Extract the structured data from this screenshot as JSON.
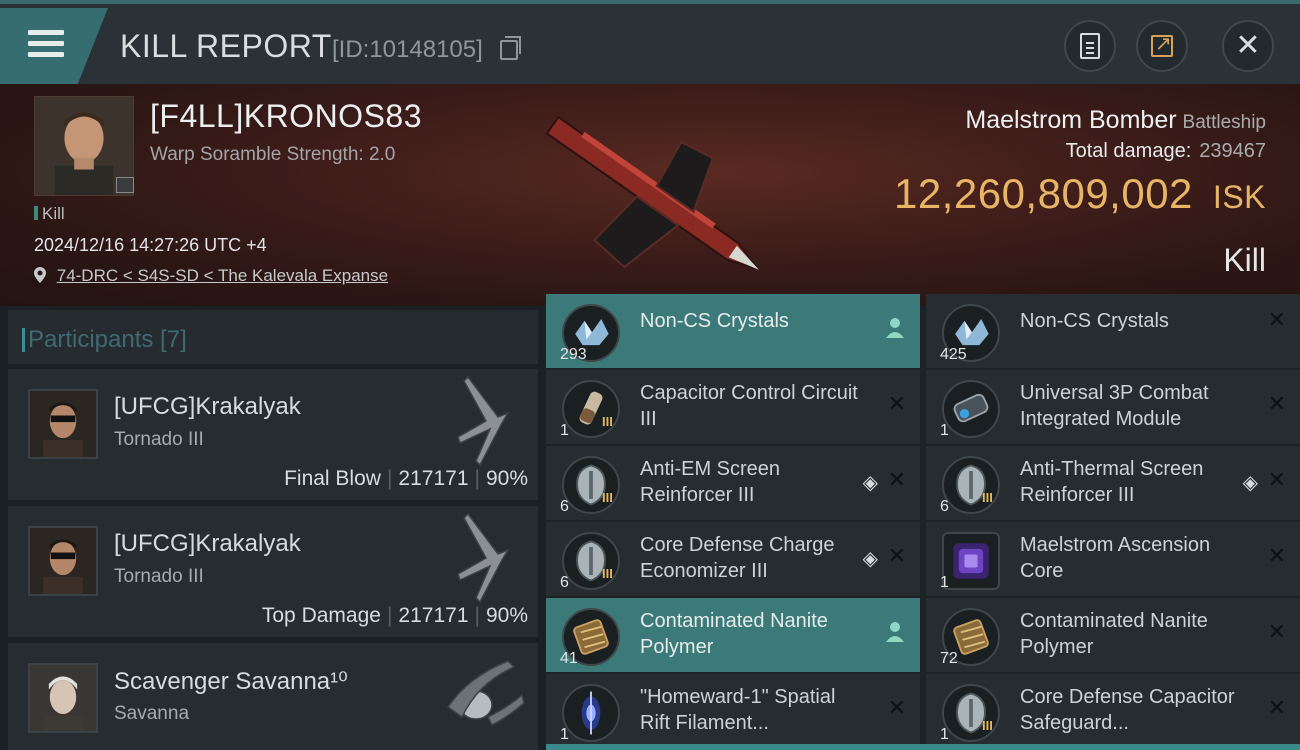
{
  "header": {
    "title": "KILL REPORT",
    "report_id": "[ID:10148105]"
  },
  "victim": {
    "name": "[F4LL]KRONOS83",
    "scramble": "Warp Soramble Strength: 2.0",
    "kill_tag": "Kill",
    "timestamp": "2024/12/16 14:27:26 UTC +4",
    "location": "74-DRC < S4S-SD < The Kalevala Expanse",
    "ship": "Maelstrom Bomber",
    "ship_class": "Battleship",
    "total_damage_label": "Total damage:",
    "total_damage": "239467",
    "isk_value": "12,260,809,002",
    "isk_unit": "ISK",
    "result": "Kill"
  },
  "participants": {
    "label": "Participants [7]",
    "rows": [
      {
        "name": "[UFCG]Krakalyak",
        "ship": "Tornado III",
        "role": "Final Blow",
        "damage": "217171",
        "percent": "90%"
      },
      {
        "name": "[UFCG]Krakalyak",
        "ship": "Tornado III",
        "role": "Top Damage",
        "damage": "217171",
        "percent": "90%"
      },
      {
        "name": "Scavenger Savanna¹⁰",
        "ship": "Savanna"
      }
    ]
  },
  "items": [
    {
      "name": "Non-CS Crystals",
      "qty": "293",
      "highlight": true
    },
    {
      "name": "Non-CS Crystals",
      "qty": "425"
    },
    {
      "name": "Capacitor Control Circuit III",
      "qty": "1",
      "tier": "III"
    },
    {
      "name": "Universal 3P Combat Integrated Module",
      "qty": "1"
    },
    {
      "name": "Anti-EM Screen Reinforcer III",
      "qty": "6",
      "tier": "III"
    },
    {
      "name": "Anti-Thermal Screen Reinforcer III",
      "qty": "6",
      "tier": "III"
    },
    {
      "name": "Core Defense Charge Economizer III",
      "qty": "6",
      "tier": "III"
    },
    {
      "name": "Maelstrom Ascension Core",
      "qty": "1"
    },
    {
      "name": "Contaminated Nanite Polymer",
      "qty": "41",
      "highlight": true
    },
    {
      "name": "Contaminated Nanite Polymer",
      "qty": "72"
    },
    {
      "name": "\"Homeward-1\" Spatial Rift Filament...",
      "qty": "1"
    },
    {
      "name": "Core Defense Capacitor Safeguard...",
      "qty": "1",
      "tier": "III"
    }
  ],
  "colors": {
    "accent": "#3b7a78",
    "isk": "#e8b566",
    "tier": "#e3b85d"
  }
}
